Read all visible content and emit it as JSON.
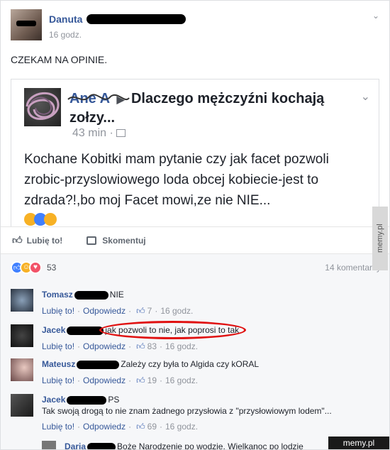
{
  "post": {
    "author": "Danuta",
    "time": "16 godz.",
    "text": "CZEKAM NA OPINIE."
  },
  "shared": {
    "author_partial": "Ane   A",
    "title": "Dlaczego mężczyźni kochają zołzy...",
    "time": "43 min ·",
    "body": "Kochane Kobitki mam pytanie czy jak facet pozwoli zrobic-przyslowiowego loda obcej kobiecie-jest to zdrada?!,bo moj Facet mowi,ze nie NIE..."
  },
  "actions": {
    "like": "Lubię to!",
    "comment": "Skomentuj"
  },
  "summary": {
    "reactions_count": "53",
    "comments_count": "14 komentarzy"
  },
  "comment_labels": {
    "like": "Lubię to!",
    "reply": "Odpowiedz"
  },
  "comments": [
    {
      "name": "Tomasz",
      "text": "NIE",
      "likes": "7",
      "time": "16 godz."
    },
    {
      "name": "Jacek",
      "text": "jak pozwoli to nie, jak poprosi to tak",
      "likes": "83",
      "time": "16 godz."
    },
    {
      "name": "Mateusz",
      "text": "Zależy czy była to Algida czy kORAL",
      "likes": "19",
      "time": "16 godz."
    },
    {
      "name": "Jacek",
      "text": "PS",
      "text2": "Tak swoją drogą to nie znam żadnego przysłowia z \"przysłowiowym lodem\"...",
      "likes": "69",
      "time": "16 godz."
    },
    {
      "name": "Daria",
      "text": "Boże Narodzenie po wodzie. Wielkanoc po lodzie"
    }
  ],
  "watermarks": {
    "side": "memy.pl",
    "bottom": "memy.pl"
  },
  "colors": {
    "link_blue": "#365899",
    "like_blue": "#4080ff",
    "highlight_red": "#e01010"
  }
}
